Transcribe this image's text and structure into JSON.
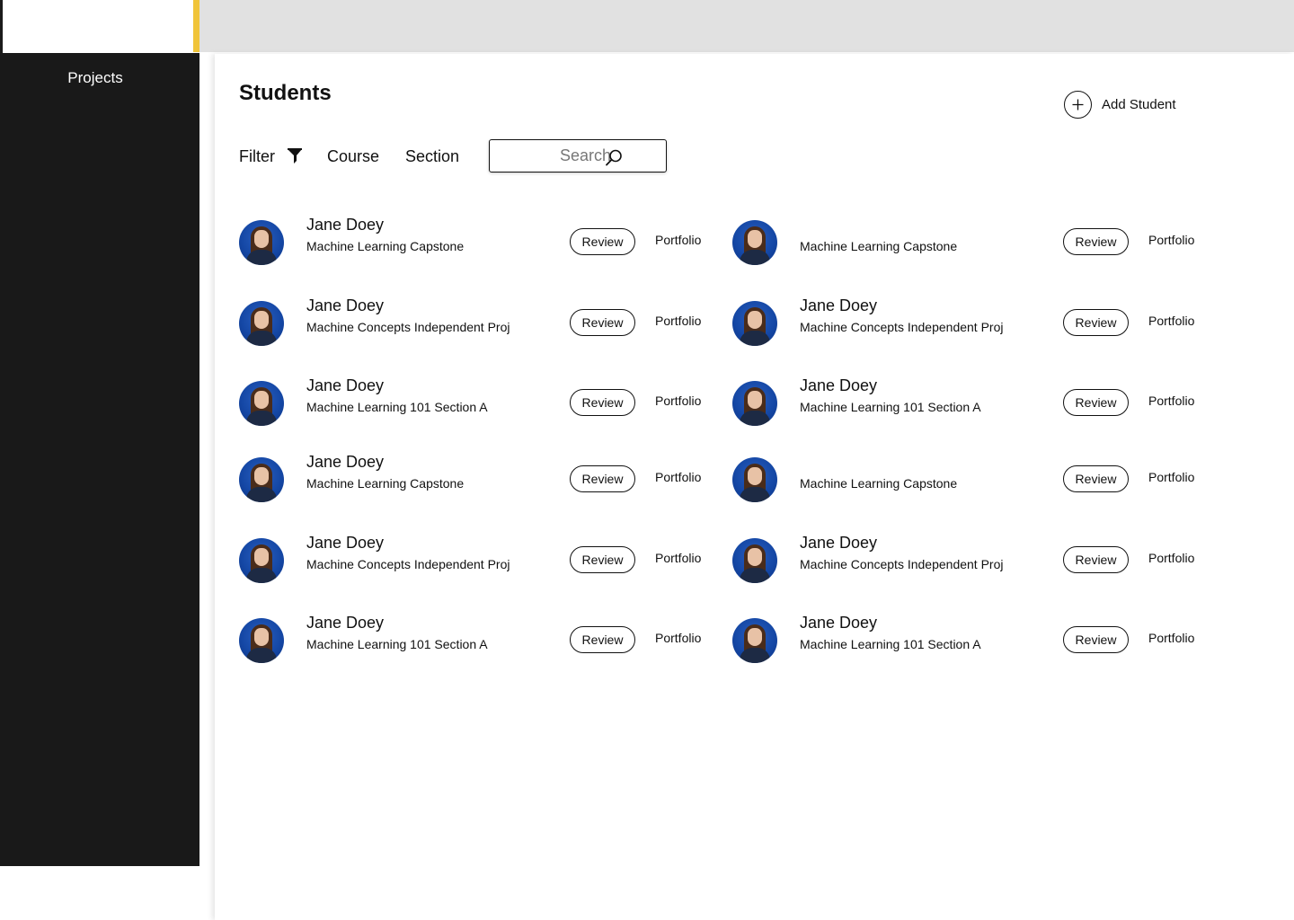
{
  "sidebar": {
    "items": [
      {
        "label": "Projects"
      }
    ]
  },
  "colors": {
    "accent": "#f0c43a",
    "sidebar_bg": "#191919",
    "topbar_bg": "#e1e1e1",
    "avatar_bg": "#1548a6"
  },
  "main": {
    "title": "Students",
    "add_student_label": "Add Student",
    "add_icon": "plus-circle-icon"
  },
  "toolbar": {
    "filter_label": "Filter",
    "filter_icon": "funnel-icon",
    "course_label": "Course",
    "section_label": "Section",
    "search_placeholder": "Search",
    "search_value": "",
    "search_icon": "magnifier-icon"
  },
  "students": [
    {
      "name": "Jane Doey",
      "course": "Machine Learning Capstone",
      "review_label": "Review",
      "portfolio_label": "Portfolio"
    },
    {
      "name": "",
      "course": "Machine Learning Capstone",
      "review_label": "Review",
      "portfolio_label": "Portfolio"
    },
    {
      "name": "Jane Doey",
      "course": "Machine Concepts Independent Proj",
      "review_label": "Review",
      "portfolio_label": "Portfolio"
    },
    {
      "name": "Jane Doey",
      "course": "Machine Concepts Independent Proj",
      "review_label": "Review",
      "portfolio_label": "Portfolio"
    },
    {
      "name": "Jane Doey",
      "course": "Machine Learning 101 Section A",
      "review_label": "Review",
      "portfolio_label": "Portfolio"
    },
    {
      "name": "Jane Doey",
      "course": "Machine Learning 101 Section A",
      "review_label": "Review",
      "portfolio_label": "Portfolio"
    },
    {
      "name": "Jane Doey",
      "course": "Machine Learning Capstone",
      "review_label": "Review",
      "portfolio_label": "Portfolio"
    },
    {
      "name": "",
      "course": "Machine Learning Capstone",
      "review_label": "Review",
      "portfolio_label": "Portfolio"
    },
    {
      "name": "Jane Doey",
      "course": "Machine Concepts Independent Proj",
      "review_label": "Review",
      "portfolio_label": "Portfolio"
    },
    {
      "name": "Jane Doey",
      "course": "Machine Concepts Independent Proj",
      "review_label": "Review",
      "portfolio_label": "Portfolio"
    },
    {
      "name": "Jane Doey",
      "course": "Machine Learning 101 Section A",
      "review_label": "Review",
      "portfolio_label": "Portfolio"
    },
    {
      "name": "Jane Doey",
      "course": "Machine Learning 101 Section A",
      "review_label": "Review",
      "portfolio_label": "Portfolio"
    }
  ]
}
